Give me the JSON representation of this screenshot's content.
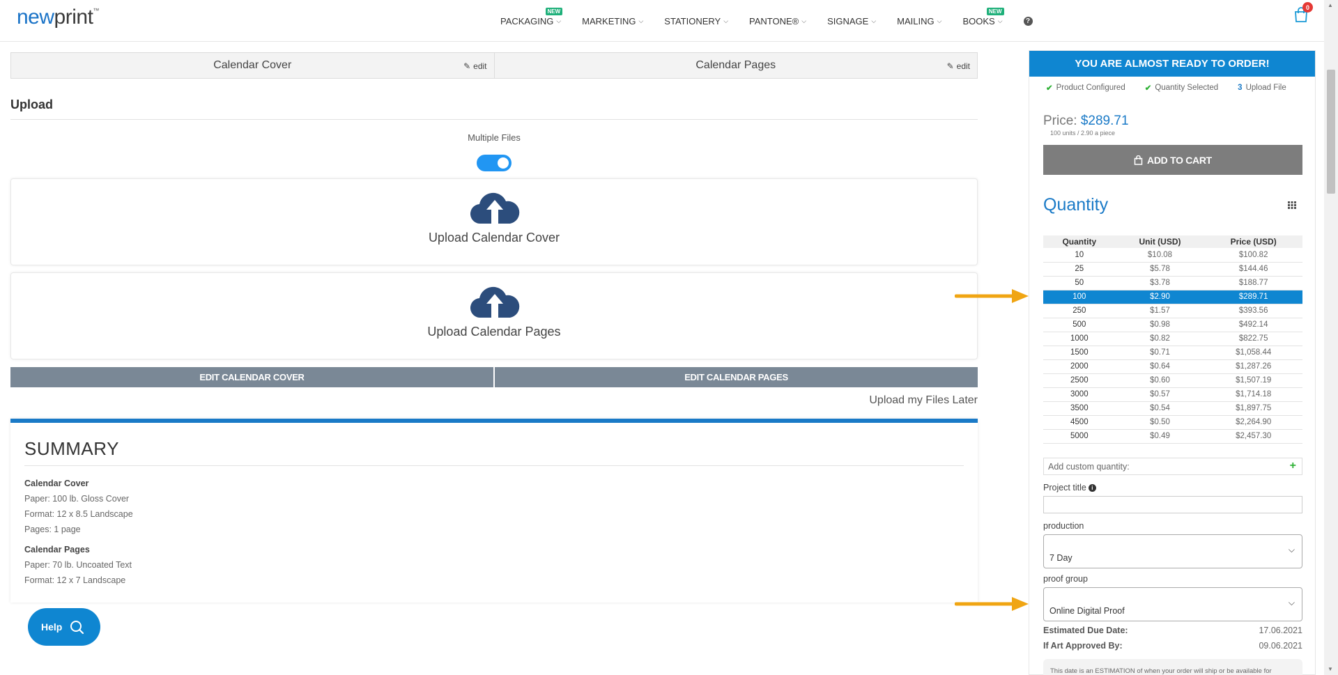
{
  "header": {
    "logo_new": "new",
    "logo_print": "print",
    "logo_tm": "™",
    "nav": [
      {
        "label": "PACKAGING",
        "badge": "NEW"
      },
      {
        "label": "MARKETING",
        "badge": ""
      },
      {
        "label": "STATIONERY",
        "badge": ""
      },
      {
        "label": "PANTONE®",
        "badge": ""
      },
      {
        "label": "SIGNAGE",
        "badge": ""
      },
      {
        "label": "MAILING",
        "badge": ""
      },
      {
        "label": "BOOKS",
        "badge": "NEW"
      }
    ],
    "help_glyph": "?",
    "cart_count": "0"
  },
  "tabs": [
    {
      "label": "Calendar Cover",
      "edit": "edit"
    },
    {
      "label": "Calendar Pages",
      "edit": "edit"
    }
  ],
  "upload": {
    "heading": "Upload",
    "multiple_files_label": "Multiple Files",
    "multiple_files_enabled": true,
    "dropzones": [
      "Upload Calendar Cover",
      "Upload Calendar Pages"
    ],
    "edit_buttons": [
      "EDIT CALENDAR COVER",
      "EDIT CALENDAR PAGES"
    ],
    "upload_later": "Upload my Files Later"
  },
  "summary": {
    "title": "SUMMARY",
    "groups": [
      {
        "title": "Calendar Cover",
        "lines": [
          "Paper: 100 lb. Gloss Cover",
          "Format: 12 x 8.5 Landscape",
          "Pages: 1 page"
        ]
      },
      {
        "title": "Calendar Pages",
        "lines": [
          "Paper: 70 lb. Uncoated Text",
          "Format: 12 x 7 Landscape"
        ]
      }
    ]
  },
  "help_button": "Help",
  "sidebar": {
    "banner": "YOU ARE ALMOST READY TO ORDER!",
    "steps": [
      {
        "label": "Product Configured",
        "state": "done"
      },
      {
        "label": "Quantity Selected",
        "state": "done"
      },
      {
        "label": "Upload File",
        "state": "current",
        "num": "3"
      }
    ],
    "price_label": "Price:",
    "price_value": "$289.71",
    "price_sub": "100 units / 2.90 a piece",
    "add_to_cart": "ADD TO CART",
    "quantity_title": "Quantity",
    "table": {
      "headers": [
        "Quantity",
        "Unit (USD)",
        "Price (USD)"
      ],
      "rows": [
        [
          "10",
          "$10.08",
          "$100.82"
        ],
        [
          "25",
          "$5.78",
          "$144.46"
        ],
        [
          "50",
          "$3.78",
          "$188.77"
        ],
        [
          "100",
          "$2.90",
          "$289.71"
        ],
        [
          "250",
          "$1.57",
          "$393.56"
        ],
        [
          "500",
          "$0.98",
          "$492.14"
        ],
        [
          "1000",
          "$0.82",
          "$822.75"
        ],
        [
          "1500",
          "$0.71",
          "$1,058.44"
        ],
        [
          "2000",
          "$0.64",
          "$1,287.26"
        ],
        [
          "2500",
          "$0.60",
          "$1,507.19"
        ],
        [
          "3000",
          "$0.57",
          "$1,714.18"
        ],
        [
          "3500",
          "$0.54",
          "$1,897.75"
        ],
        [
          "4500",
          "$0.50",
          "$2,264.90"
        ],
        [
          "5000",
          "$0.49",
          "$2,457.30"
        ]
      ],
      "selected_index": 3
    },
    "custom_quantity_placeholder": "Add custom quantity:",
    "project_title_label": "Project title",
    "production_label": "production",
    "production_value": "7 Day",
    "proof_group_label": "proof group",
    "proof_group_value": "Online Digital Proof",
    "estimated_due_label": "Estimated Due Date:",
    "estimated_due_value": "17.06.2021",
    "art_approved_label": "If Art Approved By:",
    "art_approved_value": "09.06.2021",
    "note": "This date is an ESTIMATION of when your order will ship or be available for"
  },
  "colors": {
    "accent": "#0f86d1",
    "arrow": "#f0a513",
    "edit_button": "#7a8896",
    "check": "#2eb135"
  }
}
